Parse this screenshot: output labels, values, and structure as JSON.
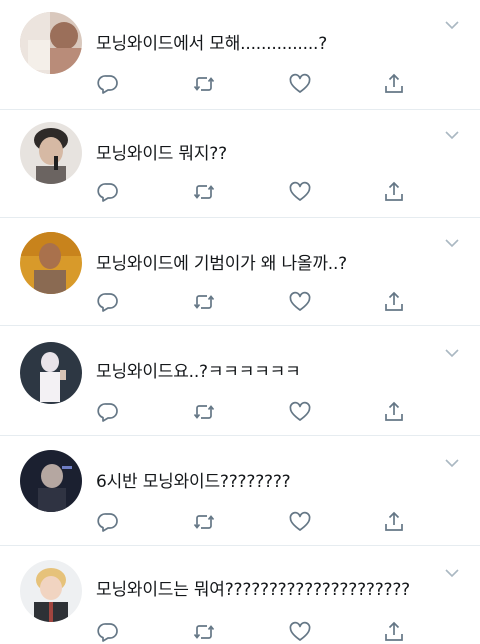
{
  "colors": {
    "icon": "#657786",
    "text": "#14171a",
    "divider": "#e6ecf0",
    "header_placeholder": "#c9ccd0"
  },
  "icons": {
    "reply": "reply-icon",
    "retweet": "retweet-icon",
    "like": "heart-icon",
    "share": "share-icon",
    "caret": "chevron-down-icon"
  },
  "tweets": [
    {
      "text": "모닝와이드에서 모해...............?"
    },
    {
      "text": "모닝와이드 뭐지??"
    },
    {
      "text": "모닝와이드에 기범이가 왜 나올까..?"
    },
    {
      "text": "모닝와이드요..?ㅋㅋㅋㅋㅋㅋ"
    },
    {
      "text": "6시반 모닝와이드????????"
    },
    {
      "text": "모닝와이드는 뭐여?????????????????????"
    }
  ]
}
